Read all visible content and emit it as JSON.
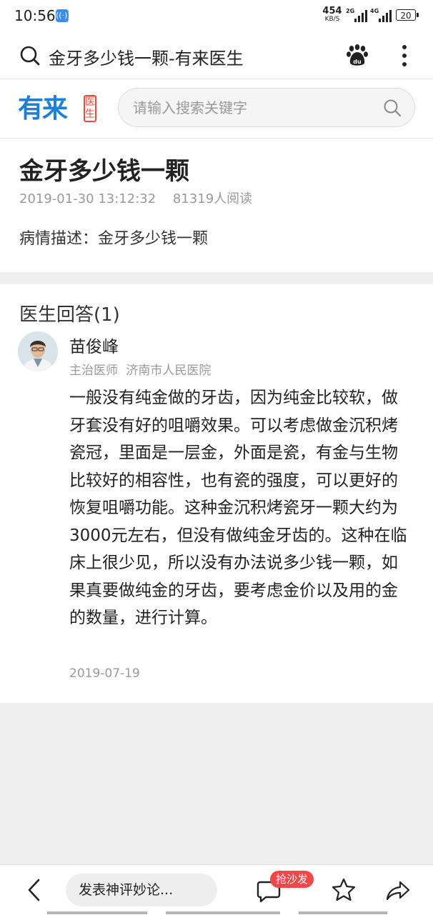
{
  "status_bar": {
    "time": "10:56",
    "net_speed": "454",
    "net_speed_unit": "KB/S",
    "signal_1": "2G",
    "signal_2": "4G",
    "battery": "20"
  },
  "browser": {
    "title": "金牙多少钱一颗-有来医生"
  },
  "site": {
    "logo_text": "有来",
    "logo_tag": "医生",
    "search_placeholder": "请输入搜索关键字"
  },
  "article": {
    "title": "金牙多少钱一颗",
    "date": "2019-01-30 13:12:32",
    "reads": "81319人阅读",
    "illness_description": "病情描述：金牙多少钱一颗"
  },
  "answers": {
    "heading": "医生回答(1)",
    "items": [
      {
        "doctor_name": "苗俊峰",
        "doctor_title": "主治医师",
        "hospital": "济南市人民医院",
        "text": "一般没有纯金做的牙齿，因为纯金比较软，做牙套没有好的咀嚼效果。可以考虑做金沉积烤瓷冠，里面是一层金，外面是瓷，有金与生物比较好的相容性，也有瓷的强度，可以更好的恢复咀嚼功能。这种金沉积烤瓷牙一颗大约为3000元左右，但没有做纯金牙齿的。这种在临床上很少见，所以没有办法说多少钱一颗，如果真要做纯金的牙齿，要考虑金价以及用的金的数量，进行计算。",
        "date": "2019-07-19"
      }
    ]
  },
  "bottom_bar": {
    "comment_placeholder": "发表神评妙论...",
    "sofa_badge": "抢沙发"
  },
  "colors": {
    "brand_blue": "#1f7ed6",
    "brand_red": "#e94b3c",
    "badge_red": "#f04848"
  },
  "icons": [
    "search-icon",
    "baidu-icon",
    "more-icon",
    "back-icon",
    "comment-icon",
    "star-icon",
    "share-icon"
  ]
}
